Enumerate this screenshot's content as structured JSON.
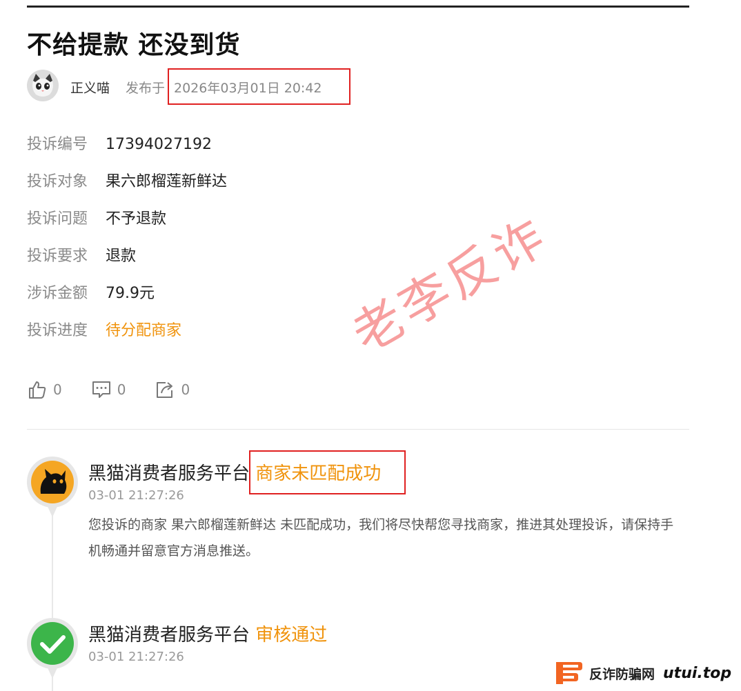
{
  "article": {
    "title": "不给提款 还没到货",
    "author_name": "正义喵",
    "publish_label": "发布于",
    "publish_date": "2026年03月01日 20:42"
  },
  "complaint_info": [
    {
      "label": "投诉编号",
      "value": "17394027192"
    },
    {
      "label": "投诉对象",
      "value": "果六郎榴莲新鲜达"
    },
    {
      "label": "投诉问题",
      "value": "不予退款"
    },
    {
      "label": "投诉要求",
      "value": "退款"
    },
    {
      "label": "涉诉金额",
      "value": "79.9元"
    },
    {
      "label": "投诉进度",
      "value": "待分配商家"
    }
  ],
  "actions": {
    "like_count": "0",
    "comment_count": "0",
    "share_count": "0"
  },
  "timeline": [
    {
      "source": "黑猫消费者服务平台",
      "status": "商家未匹配成功",
      "time": "03-01 21:27:26",
      "description": "您投诉的商家 果六郎榴莲新鲜达 未匹配成功，我们将尽快帮您寻找商家，推进其处理投诉，请保持手机畅通并留意官方消息推送。"
    },
    {
      "source": "黑猫消费者服务平台",
      "status": "审核通过",
      "time": "03-01 21:27:26"
    }
  ],
  "watermark": "老李反诈",
  "brand": {
    "name": "反诈防骗网",
    "url": "utui.top"
  },
  "colors": {
    "status_orange": "#f0930c",
    "highlight_red": "#e02020",
    "check_green": "#3cb54a",
    "brand_orange": "#f26522"
  }
}
